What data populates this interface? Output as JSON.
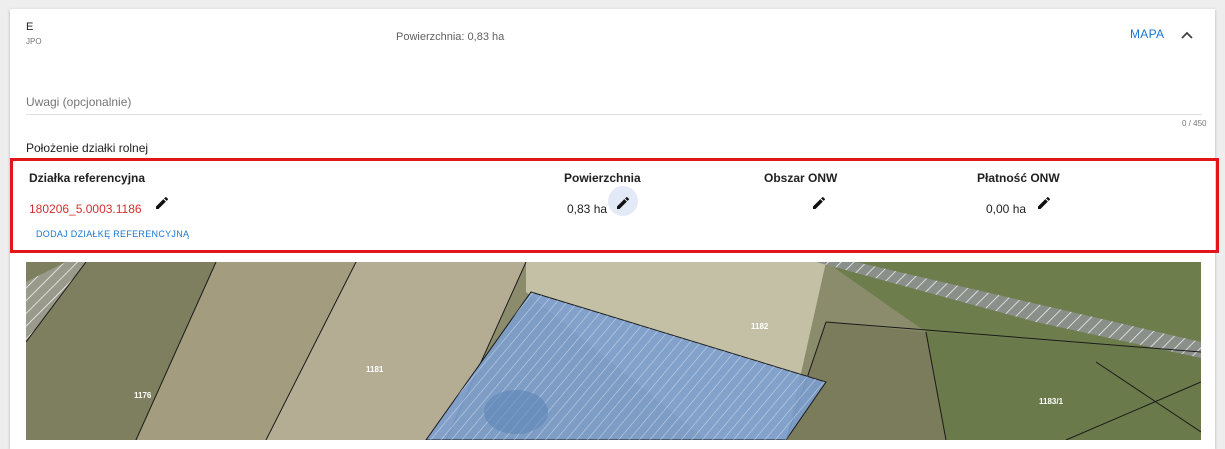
{
  "header": {
    "code": "E",
    "subcode": "JPO",
    "area_text": "Powierzchnia: 0,83 ha",
    "map_button": "MAPA",
    "collapse_icon": "chevron-up-icon"
  },
  "notes": {
    "placeholder": "Uwagi (opcjonalnie)",
    "value": "",
    "counter": "0 / 450"
  },
  "location": {
    "section_title": "Położenie działki rolnej",
    "columns": [
      "Działka referencyjna",
      "Powierzchnia",
      "Obszar ONW",
      "Płatność ONW"
    ],
    "row": {
      "parcel_id": "180206_5.0003.1186",
      "area": "0,83 ha",
      "onw_area": "",
      "onw_payment": "0,00 ha"
    },
    "add_button": "DODAJ DZIAŁKĘ REFERENCYJNĄ",
    "highlight_color": "#e0161b",
    "link_color": "#d32f2f",
    "edit_icon": "pencil-icon"
  },
  "map": {
    "parcel_labels": [
      "1176",
      "1181",
      "1182",
      "1183/1"
    ],
    "selected_fill": "#7c9fcf"
  }
}
